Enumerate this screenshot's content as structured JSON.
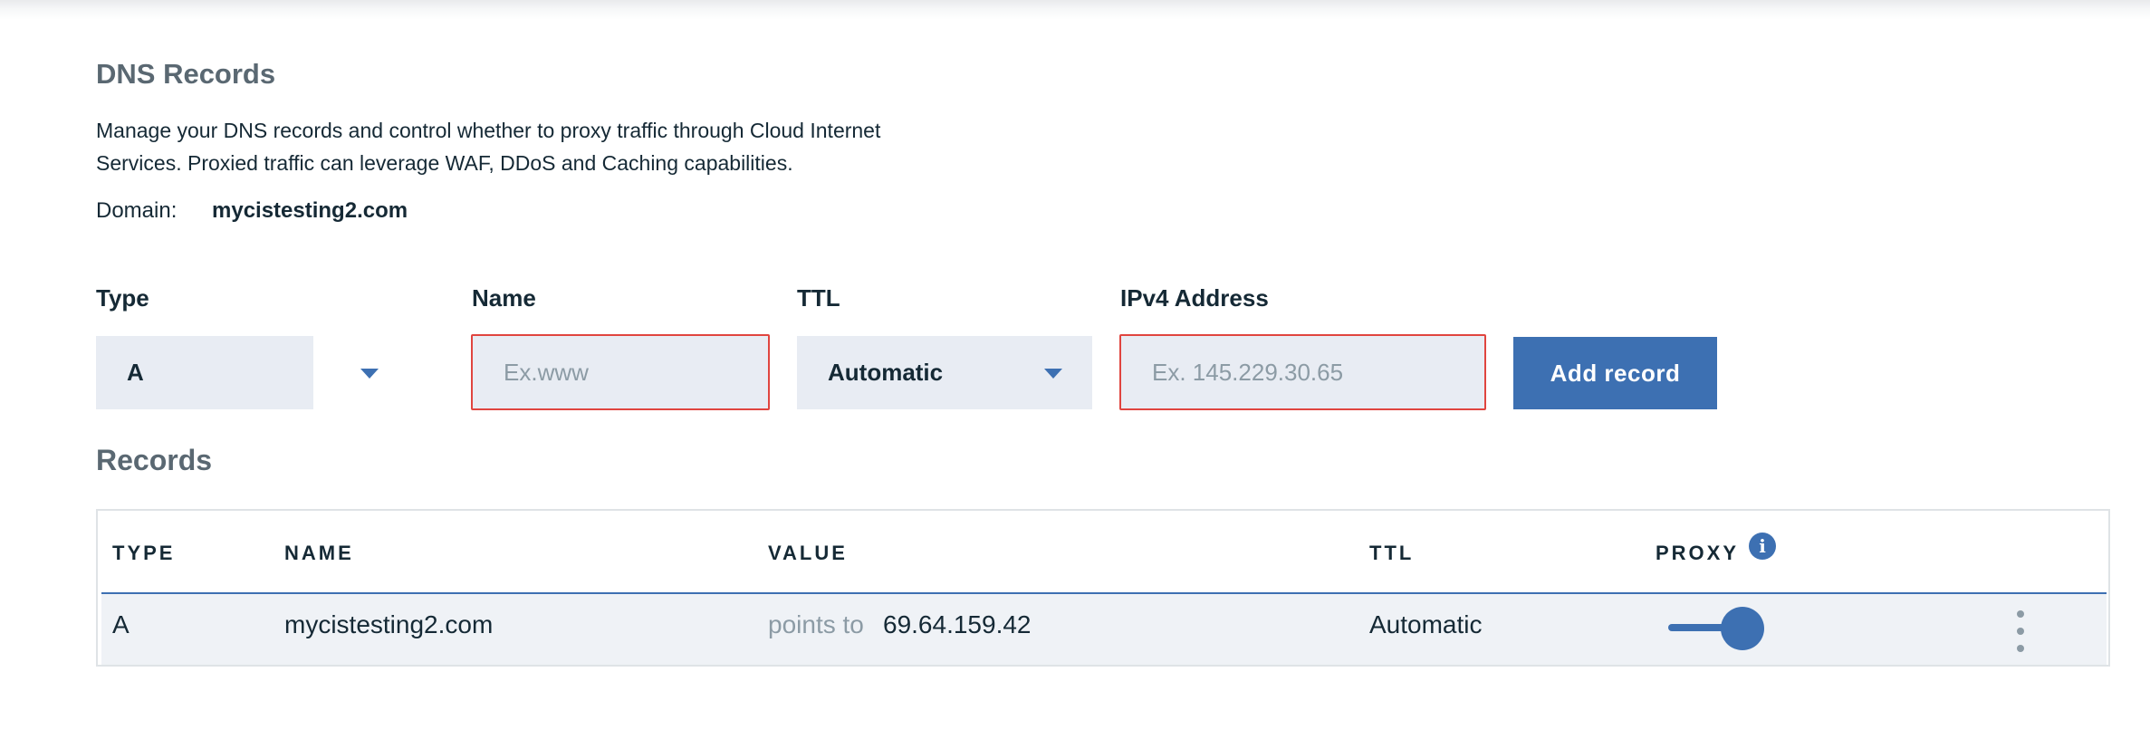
{
  "page": {
    "title": "DNS Records",
    "description": "Manage your DNS records and control whether to proxy traffic through Cloud Internet Services. Proxied traffic can leverage WAF, DDoS and Caching capabilities.",
    "domain_label": "Domain:",
    "domain_value": "mycistesting2.com"
  },
  "form": {
    "type_label": "Type",
    "type_value": "A",
    "name_label": "Name",
    "name_placeholder": "Ex.www",
    "ttl_label": "TTL",
    "ttl_value": "Automatic",
    "ipv4_label": "IPv4 Address",
    "ipv4_placeholder": "Ex. 145.229.30.65",
    "add_button": "Add record"
  },
  "records": {
    "title": "Records",
    "columns": [
      "TYPE",
      "NAME",
      "VALUE",
      "TTL",
      "PROXY"
    ],
    "rows": [
      {
        "type": "A",
        "name": "mycistesting2.com",
        "value_prefix": "points to",
        "value": "69.64.159.42",
        "ttl": "Automatic",
        "proxy_on": true
      }
    ]
  },
  "icons": {
    "caret": "chevron-down-icon",
    "info": "info-icon",
    "overflow": "overflow-menu-icon"
  },
  "colors": {
    "accent": "#3d70b2",
    "error_border": "#e0453f",
    "field_bg": "#e8ecf3",
    "row_bg": "#eff2f6"
  }
}
